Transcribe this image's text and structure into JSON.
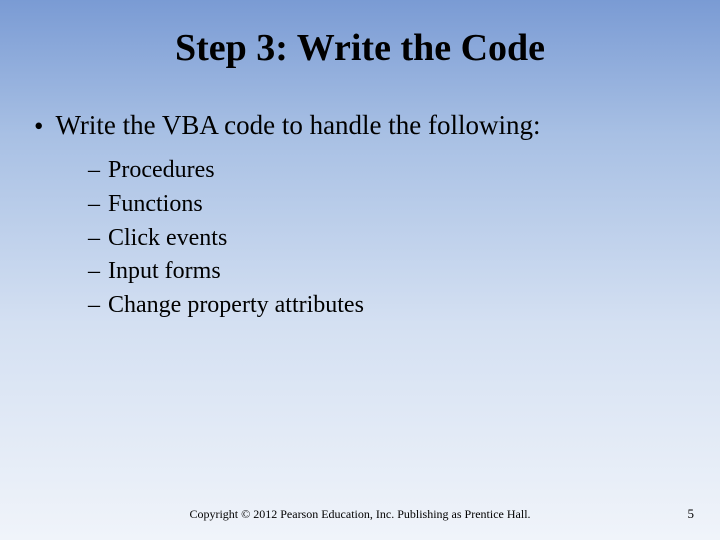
{
  "title": "Step 3: Write the Code",
  "mainBullet": "Write the VBA code to handle the following:",
  "subItems": [
    "Procedures",
    "Functions",
    "Click events",
    "Input forms",
    "Change property attributes"
  ],
  "copyright": "Copyright © 2012 Pearson Education, Inc. Publishing as Prentice Hall.",
  "pageNumber": "5"
}
